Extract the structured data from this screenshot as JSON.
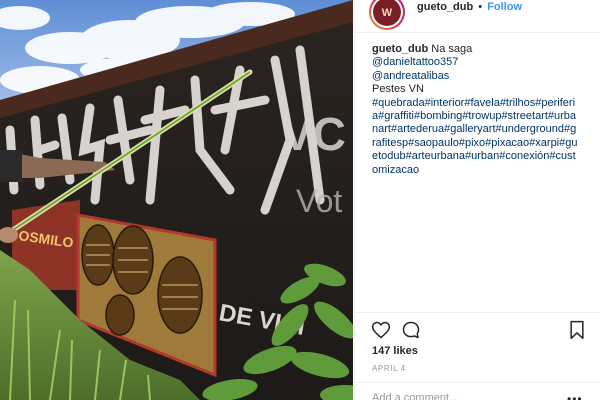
{
  "post": {
    "username": "gueto_dub",
    "separator": "•",
    "follow_label": "Follow",
    "avatar_text": "W"
  },
  "caption": {
    "username": "gueto_dub",
    "title": "Na saga",
    "mentions": [
      "@danieltattoo357",
      "@andreatalibas"
    ],
    "subtitle": "Pestes VN",
    "hashtag_lines": [
      "#quebrada#interior#favela#trilhos#periferi",
      "a#graffiti#bombing#trowup#streetart#urba",
      "nart#artederua#galleryart#underground#g",
      "rafitesp#saopaulo#pixo#pixacao#xarpi#gu",
      "etodub#arteurbana#urban#conexión#cust",
      "omizacao"
    ]
  },
  "photo": {
    "wall_text_large": "VC",
    "wall_text_small": "Vot",
    "wall_text_bottom": "DE VIAI",
    "wall_text_red": "OSMILO"
  },
  "actions": {
    "like_icon": "heart-icon",
    "comment_icon": "comment-icon",
    "save_icon": "bookmark-icon"
  },
  "likes_text": "147 likes",
  "date_text": "APRIL 4",
  "comment": {
    "placeholder": "Add a comment…",
    "more_label": "•••"
  },
  "colors": {
    "follow": "#3897f0",
    "hashtag": "#003569",
    "border": "#efefef",
    "muted": "#999999"
  }
}
